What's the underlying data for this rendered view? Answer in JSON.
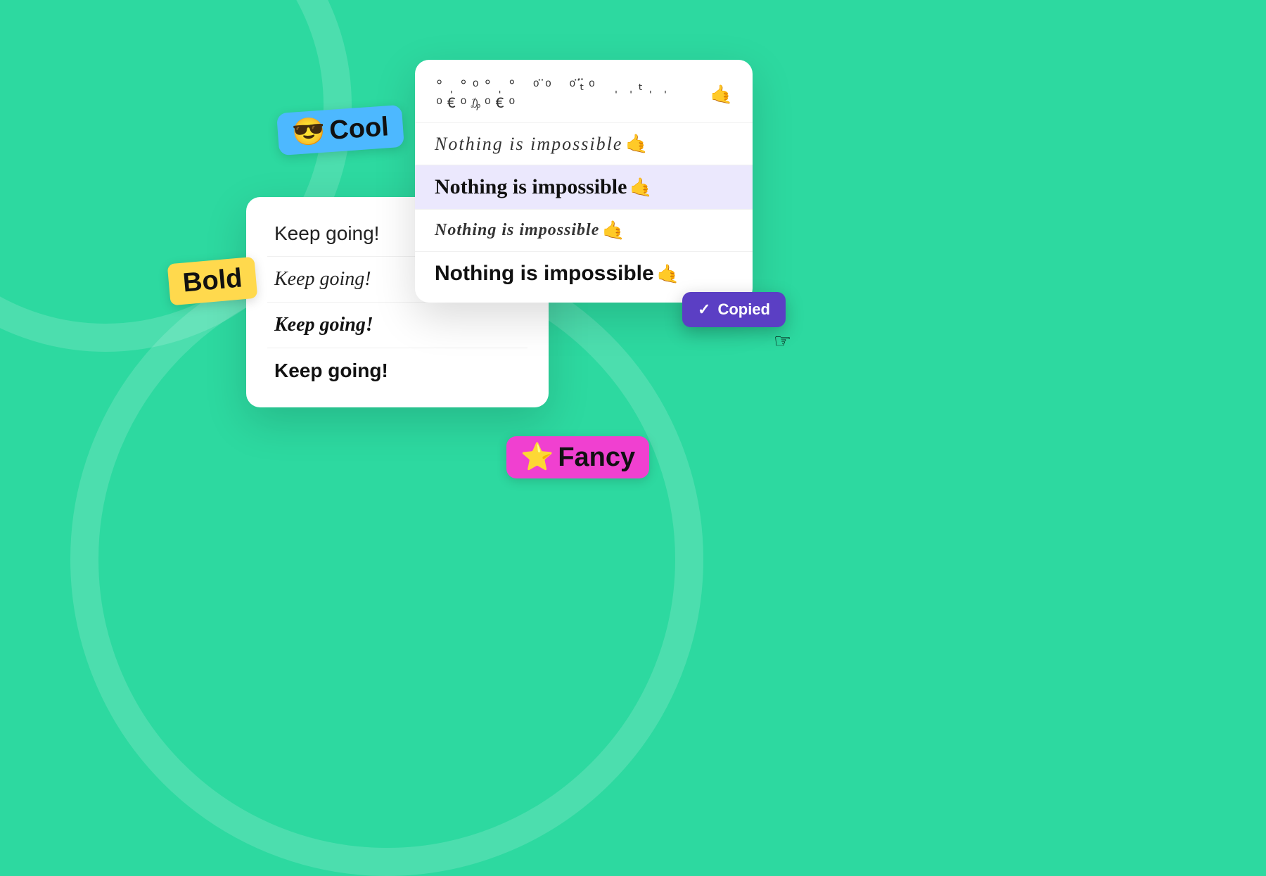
{
  "background": {
    "color": "#2dd9a0"
  },
  "stickers": {
    "cool": {
      "emoji": "😎",
      "label": "Cool",
      "bg": "#4db8ff"
    },
    "bold": {
      "label": "Bold",
      "bg": "#ffd94d"
    },
    "fancy": {
      "emoji": "⭐",
      "label": "Fancy",
      "bg": "#f040d0"
    }
  },
  "card_back": {
    "rows": [
      {
        "text": "Keep going!",
        "style": "normal"
      },
      {
        "text": "Keep going!",
        "style": "italic"
      },
      {
        "text": "Keep going!",
        "style": "bold-italic"
      },
      {
        "text": "Keep going!",
        "style": "bold"
      }
    ]
  },
  "card_front": {
    "rows": [
      {
        "text": "Nothing is impossible",
        "emoji": "🤙",
        "style": "dots",
        "selected": false
      },
      {
        "text": "Nothing is impossible",
        "emoji": "🤙",
        "style": "cursive",
        "selected": false
      },
      {
        "text": "Nothing is impossible",
        "emoji": "🤙",
        "style": "bold-serif",
        "selected": true
      },
      {
        "text": "Nothing is impossible",
        "emoji": "🤙",
        "style": "gothic",
        "selected": false
      },
      {
        "text": "Nothing is impossible",
        "emoji": "🤙",
        "style": "sans-bold",
        "selected": false
      }
    ]
  },
  "tooltip": {
    "checkmark": "✓",
    "label": "Copied"
  }
}
